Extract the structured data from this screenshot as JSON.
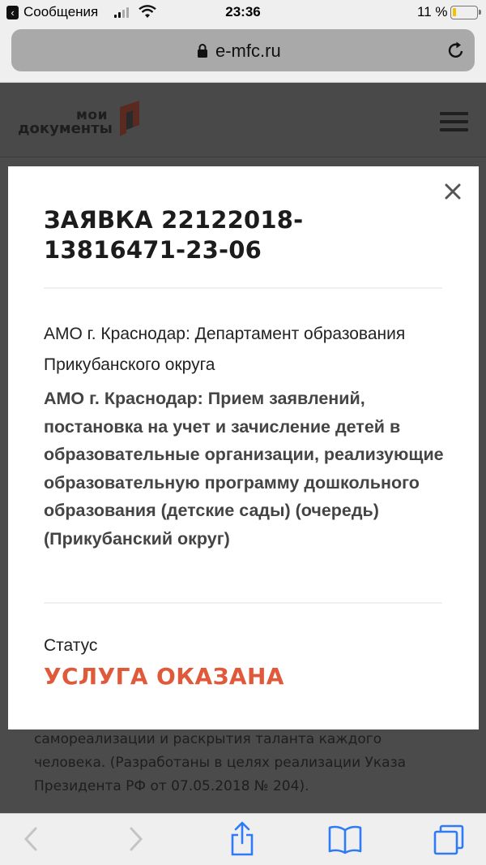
{
  "status_bar": {
    "app_name": "Сообщения",
    "time": "23:36",
    "battery": "11 %",
    "battery_level": 0.11
  },
  "browser": {
    "url": "e-mfc.ru"
  },
  "site": {
    "logo_top": "мои",
    "logo_bottom": "документы"
  },
  "background_text": "самореализации и раскрытия таланта каждого человека. (Разработаны в целях реализации Указа Президента РФ от 07.05.2018 № 204).",
  "modal": {
    "title": "ЗАЯВКА 22122018-13816471-23-06",
    "department": "АМО г. Краснодар: Департамент образования Прикубанского округа",
    "service": "АМО г. Краснодар: Прием заявлений, постановка на учет и зачисление детей в образовательные организации, реализующие образовательную программу дошкольного образования (детские сады) (очередь) (Прикубанский округ)",
    "status_label": "Статус",
    "status_value": "УСЛУГА ОКАЗАНА"
  },
  "colors": {
    "status_accent": "#e0593a",
    "logo_accent": "#cc4a2e"
  }
}
